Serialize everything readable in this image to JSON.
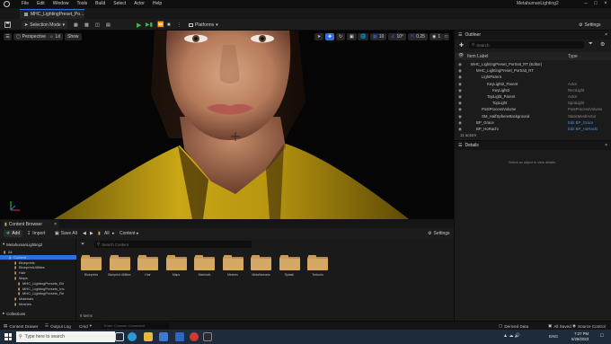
{
  "app": {
    "menu": [
      "File",
      "Edit",
      "Window",
      "Tools",
      "Build",
      "Select",
      "Actor",
      "Help"
    ],
    "window_title": "MetahumanLighting2",
    "doc_tab": "MHC_LightingPreset_Po..."
  },
  "toolbar": {
    "selection_mode": "Selection Mode",
    "platforms": "Platforms",
    "settings": "Settings"
  },
  "viewport": {
    "perspective": "Perspective",
    "lit": "Lit",
    "show": "Show",
    "grid_snap": "10",
    "rot_snap": "10°",
    "scale_snap": "0.25",
    "cam_speed": "1"
  },
  "outliner": {
    "title": "Outliner",
    "search_placeholder": "Search",
    "col_label": "Item Label",
    "col_type": "Type",
    "rows": [
      {
        "label": "MHC_LightingPreset_Portrait_RT (Editor)",
        "type": "",
        "indent": 18
      },
      {
        "label": "MHC_LightingPreset_Portrait_RT",
        "type": "",
        "indent": 24
      },
      {
        "label": "LightParent",
        "type": "",
        "indent": 30
      },
      {
        "label": "KeyLight2_Parent",
        "type": "Actor",
        "indent": 36
      },
      {
        "label": "KeyLight2",
        "type": "RectLight",
        "indent": 42
      },
      {
        "label": "TopLight_Parent",
        "type": "Actor",
        "indent": 36
      },
      {
        "label": "TopLight",
        "type": "SpotLight",
        "indent": 42
      },
      {
        "label": "PostProcessVolume",
        "type": "PostProcessVolume",
        "indent": 30
      },
      {
        "label": "SM_HalfSphereBackground",
        "type": "StaticMeshActor",
        "indent": 30
      },
      {
        "label": "BP_Grace",
        "type": "Edit BP_Grace",
        "indent": 24,
        "link": true
      },
      {
        "label": "BP_HoRachi",
        "type": "Edit BP_HoRachi",
        "indent": 24,
        "link": true
      }
    ],
    "count": "11 actors"
  },
  "details": {
    "title": "Details",
    "empty": "Select an object to view details."
  },
  "content_browser": {
    "tab": "Content Browser",
    "add": "Add",
    "import": "Import",
    "save_all": "Save All",
    "path_all": "All",
    "path_content": "Content",
    "settings": "Settings",
    "search_placeholder": "Search Content",
    "project": "MetahumanLighting2",
    "tree": [
      {
        "label": "All",
        "indent": 4
      },
      {
        "label": "Content",
        "indent": 10,
        "selected": true
      },
      {
        "label": "Blueprints",
        "indent": 16
      },
      {
        "label": "BlueprintUtilities",
        "indent": 16
      },
      {
        "label": "Hair",
        "indent": 16
      },
      {
        "label": "Maps",
        "indent": 16
      },
      {
        "label": "MHC_LightingPresets_Bli",
        "indent": 20
      },
      {
        "label": "MHC_LightingPresets_Ins",
        "indent": 20
      },
      {
        "label": "MHC_LightingPresets_Re",
        "indent": 20
      },
      {
        "label": "Materials",
        "indent": 16
      },
      {
        "label": "Meshes",
        "indent": 16
      }
    ],
    "collections": "Collections",
    "folders": [
      "Blueprints",
      "Blueprint Utilities",
      "Hair",
      "Maps",
      "Materials",
      "Meshes",
      "MetaHumans",
      "Splash",
      "Textures"
    ],
    "item_count": "9 items"
  },
  "statusbar": {
    "content_drawer": "Content Drawer",
    "output_log": "Output Log",
    "cmd": "Cmd",
    "console_placeholder": "Enter Console Command",
    "derived_data": "Derived Data",
    "all_saved": "All Saved",
    "source_control": "Source Control"
  },
  "taskbar": {
    "search_placeholder": "Type here to search",
    "lang": "ENG",
    "time": "7:27 PM",
    "date": "5/28/2023"
  },
  "colors": {
    "accent": "#2e6fd9",
    "folder": "#d6a866",
    "play_green": "#3fb94d",
    "shirt_yellow": "#c9a616"
  }
}
